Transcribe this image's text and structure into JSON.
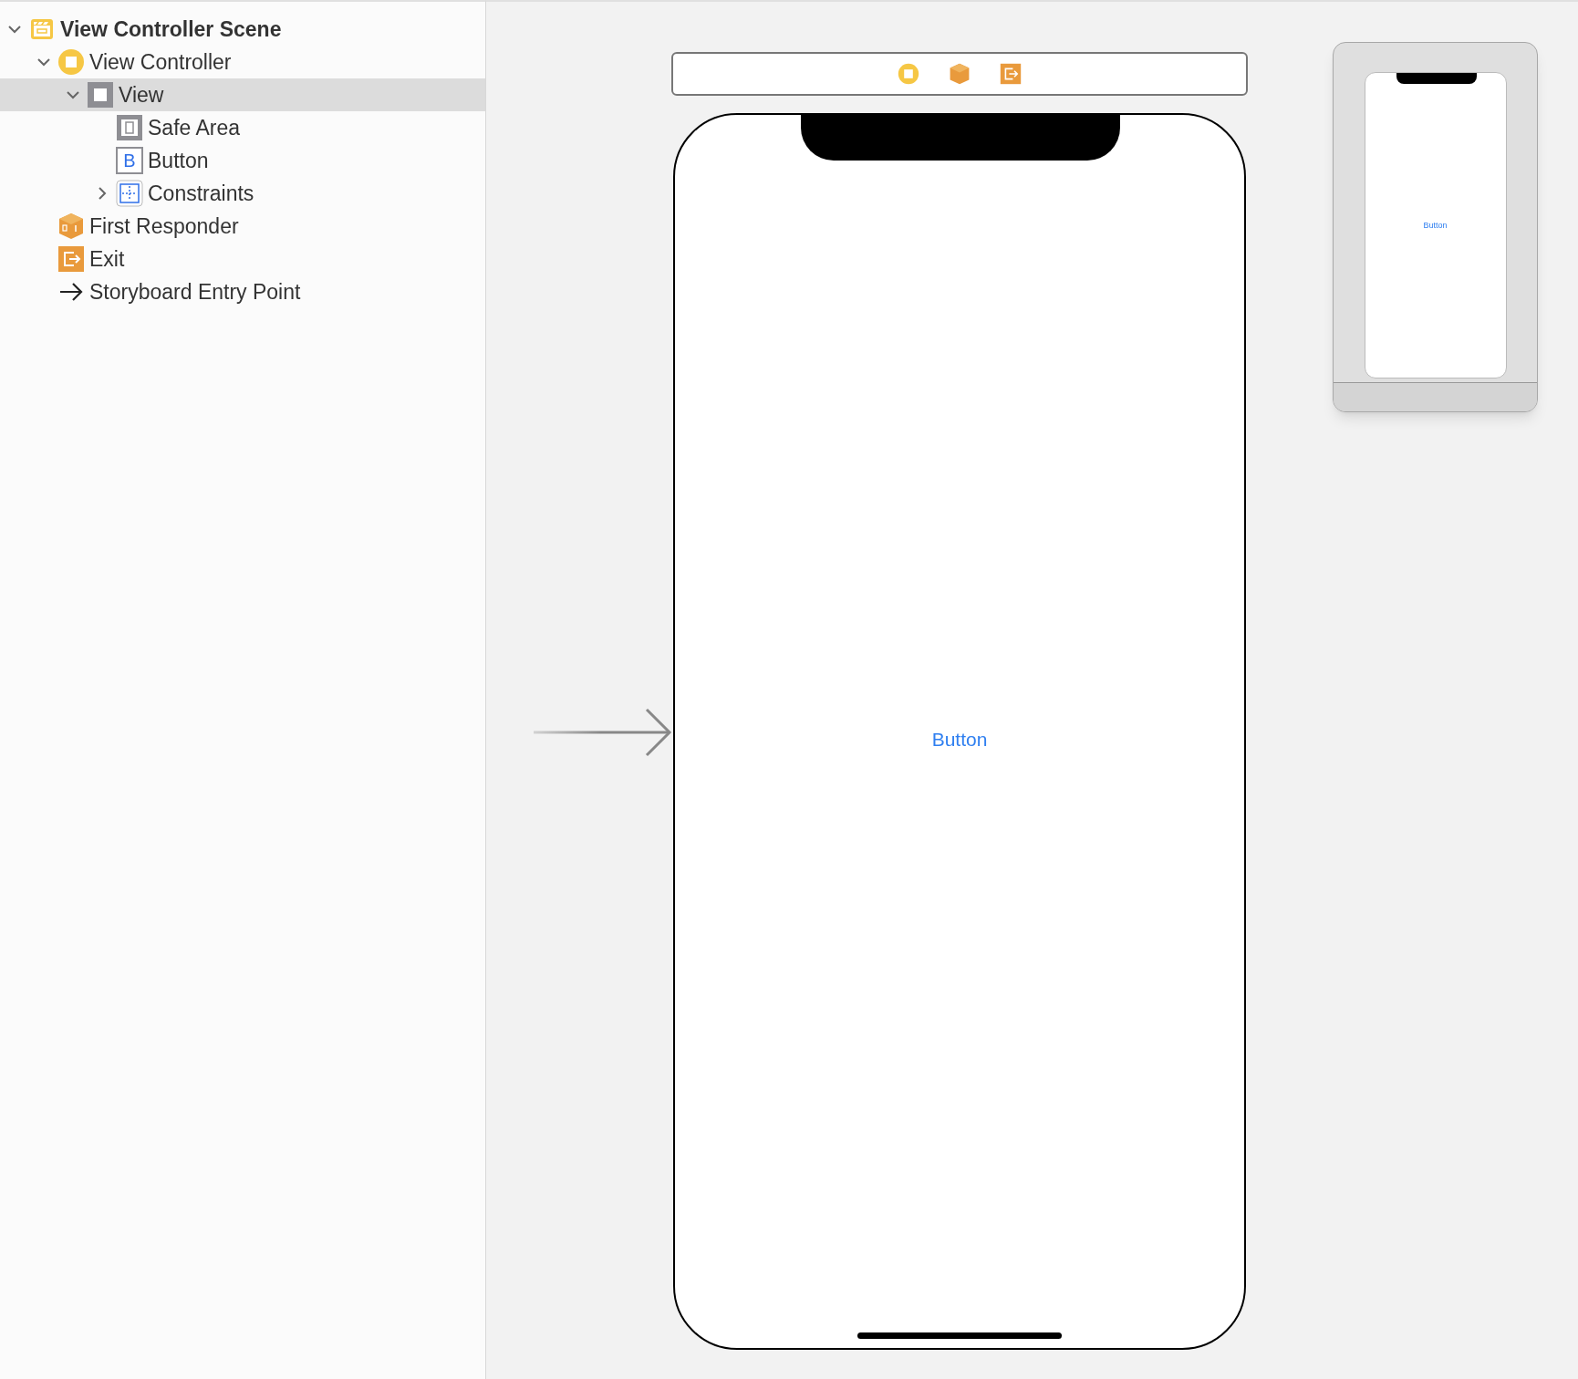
{
  "outline": [
    {
      "kind": "scene",
      "label": "View Controller Scene",
      "expanded": true,
      "selected": false,
      "children": [
        {
          "kind": "controller",
          "label": "View Controller",
          "expanded": true,
          "selected": false,
          "children": [
            {
              "kind": "view",
              "label": "View",
              "expanded": true,
              "selected": true,
              "children": [
                {
                  "kind": "safe-area",
                  "label": "Safe Area",
                  "selected": false
                },
                {
                  "kind": "button",
                  "label": "Button",
                  "icon_text": "B",
                  "selected": false
                },
                {
                  "kind": "constraints",
                  "label": "Constraints",
                  "expanded": false,
                  "selected": false
                }
              ]
            }
          ]
        },
        {
          "kind": "responder",
          "label": "First Responder",
          "selected": false
        },
        {
          "kind": "exit",
          "label": "Exit",
          "selected": false
        },
        {
          "kind": "entry",
          "label": "Storyboard Entry Point",
          "selected": false
        }
      ]
    }
  ],
  "canvas": {
    "scene_bar_icons": [
      {
        "kind": "controller"
      },
      {
        "kind": "responder"
      },
      {
        "kind": "exit"
      }
    ],
    "button_label": "Button",
    "minimap": {
      "button_label": "Button"
    }
  }
}
